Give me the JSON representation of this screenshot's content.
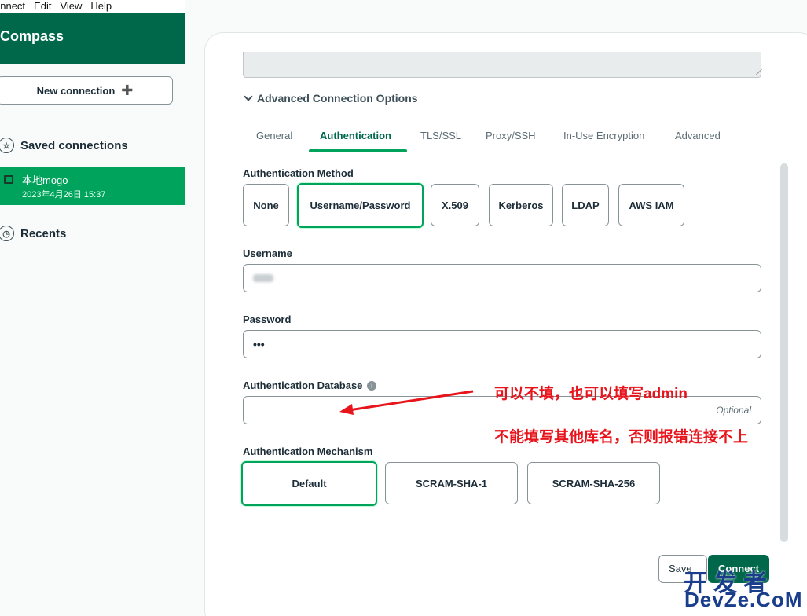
{
  "menu": [
    "onnect",
    "Edit",
    "View",
    "Help"
  ],
  "sidebar": {
    "brand": "Compass",
    "new_connection": "New connection",
    "saved_title": "Saved connections",
    "saved": [
      {
        "name": "本地mogo",
        "date": "2023年4月26日 15:37"
      }
    ],
    "recents_title": "Recents",
    "active_color": "#00a35c",
    "brand_color": "#00684a"
  },
  "form": {
    "advanced_toggle": "Advanced Connection Options",
    "tabs": [
      "General",
      "Authentication",
      "TLS/SSL",
      "Proxy/SSH",
      "In-Use Encryption",
      "Advanced"
    ],
    "active_tab": "Authentication",
    "auth_method_label": "Authentication Method",
    "auth_methods": [
      "None",
      "Username/Password",
      "X.509",
      "Kerberos",
      "LDAP",
      "AWS IAM"
    ],
    "selected_method": "Username/Password",
    "username_label": "Username",
    "password_label": "Password",
    "password_value": "•••",
    "auth_db_label": "Authentication Database",
    "auth_db_placeholder": "Optional",
    "mechanism_label": "Authentication Mechanism",
    "mechanisms": [
      "Default",
      "SCRAM-SHA-1",
      "SCRAM-SHA-256"
    ],
    "selected_mechanism": "Default"
  },
  "footer": {
    "save": "Save",
    "connect": "Connect"
  },
  "annotations": {
    "note1": "可以不填，也可以填写admin",
    "note2": "不能填写其他库名，否则报错连接不上",
    "color": "#e8141c"
  },
  "watermark": {
    "line1": "开发者",
    "line2": "DevZe.CoM"
  }
}
